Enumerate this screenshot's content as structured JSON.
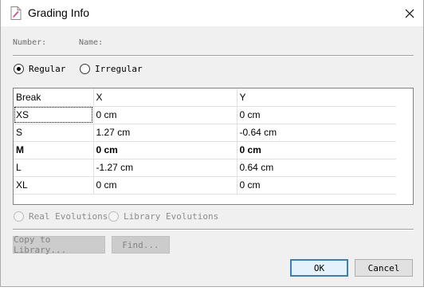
{
  "window": {
    "title": "Grading Info"
  },
  "header": {
    "number_label": "Number:",
    "name_label": "Name:"
  },
  "mode": {
    "regular_label": "Regular",
    "irregular_label": "Irregular",
    "selected": "Regular"
  },
  "grid": {
    "columns": [
      "Break",
      "X",
      "Y"
    ],
    "rows": [
      {
        "break": "XS",
        "x": "0 cm",
        "y": "0 cm"
      },
      {
        "break": "S",
        "x": "1.27 cm",
        "y": "-0.64 cm"
      },
      {
        "break": "M",
        "x": "0 cm",
        "y": "0 cm"
      },
      {
        "break": "L",
        "x": "-1.27 cm",
        "y": "0.64 cm"
      },
      {
        "break": "XL",
        "x": "0 cm",
        "y": "0 cm"
      }
    ]
  },
  "evolutions": {
    "real_label": "Real Evolutions",
    "library_label": "Library Evolutions"
  },
  "buttons": {
    "copy_label": "Copy to Library...",
    "find_label": "Find...",
    "ok_label": "OK",
    "cancel_label": "Cancel"
  }
}
